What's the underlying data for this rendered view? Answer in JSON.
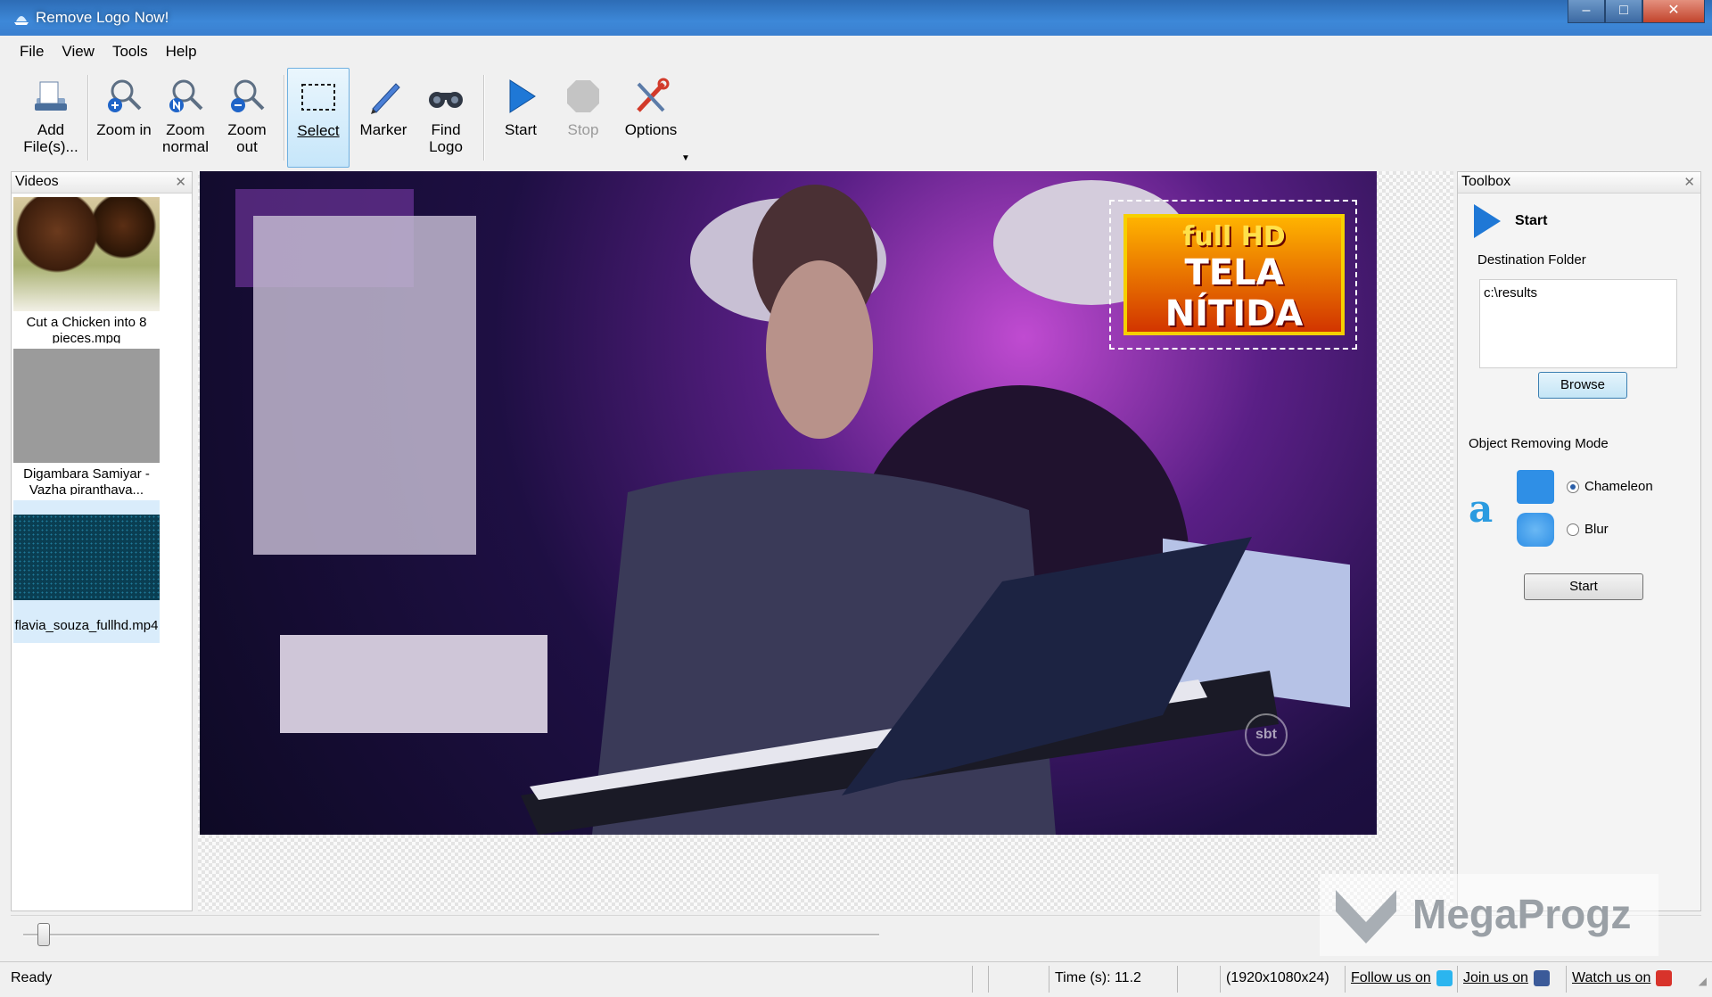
{
  "window": {
    "title": "Remove Logo Now!"
  },
  "menu": [
    "File",
    "View",
    "Tools",
    "Help"
  ],
  "toolbar": {
    "add_files": "Add File(s)...",
    "zoom_in": "Zoom in",
    "zoom_normal": "Zoom normal",
    "zoom_out": "Zoom out",
    "select": "Select",
    "marker": "Marker",
    "find_logo": "Find Logo",
    "start": "Start",
    "stop": "Stop",
    "options": "Options"
  },
  "videos_panel": {
    "title": "Videos",
    "items": [
      {
        "caption": "Cut a Chicken into 8 pieces.mpg"
      },
      {
        "caption": "Digambara Samiyar - Vazha piranthava..."
      },
      {
        "caption": "flavia_souza_fullhd.mp4"
      }
    ]
  },
  "preview": {
    "logo_lines": [
      "full HD",
      "TELA",
      "NÍTIDA"
    ],
    "channel_bug": "sbt"
  },
  "toolbox": {
    "title": "Toolbox",
    "start_label": "Start",
    "destination_label": "Destination Folder",
    "destination_value": "c:\\results",
    "browse_button": "Browse",
    "mode_label": "Object Removing Mode",
    "mode_options": [
      "Chameleon",
      "Blur"
    ],
    "selected_mode": "Chameleon",
    "start_button": "Start"
  },
  "status": {
    "ready": "Ready",
    "time": "Time (s): 11.2",
    "resolution": "(1920x1080x24)",
    "follow": "Follow us on",
    "join": "Join us on",
    "watch": "Watch us on"
  },
  "watermark": {
    "text": "MegaProgz"
  },
  "colors": {
    "accent": "#2a7fd4",
    "titlebar": "#3a7fcf",
    "selected_tool": "#c6e6fa"
  }
}
